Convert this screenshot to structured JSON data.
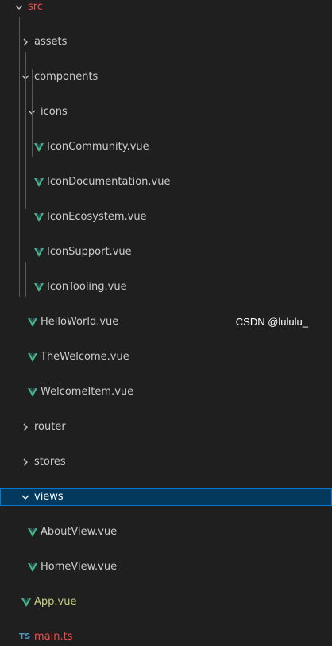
{
  "tree": {
    "src": "src",
    "assets": "assets",
    "components": "components",
    "icons": "icons",
    "icon_files": [
      "IconCommunity.vue",
      "IconDocumentation.vue",
      "IconEcosystem.vue",
      "IconSupport.vue",
      "IconTooling.vue"
    ],
    "component_files": [
      "HelloWorld.vue",
      "TheWelcome.vue",
      "WelcomeItem.vue"
    ],
    "router": "router",
    "stores": "stores",
    "views": "views",
    "view_files": [
      "AboutView.vue",
      "HomeView.vue"
    ],
    "app_vue": "App.vue",
    "main_ts": "main.ts",
    "ts_badge": "TS"
  },
  "colors": {
    "background": "#1f1f1f",
    "text": "#cccccc",
    "selection_bg": "#04395e",
    "selection_border": "#0078d4",
    "vue_green": "#41b883",
    "ts_blue": "#519aba",
    "error_red": "#f14c4c"
  },
  "icons": {
    "vue_file": "vue-logo-icon",
    "folder_open": "chevron-down-icon",
    "folder_closed": "chevron-right-icon",
    "ts_file": "typescript-icon"
  },
  "watermark": "CSDN @lululu_"
}
